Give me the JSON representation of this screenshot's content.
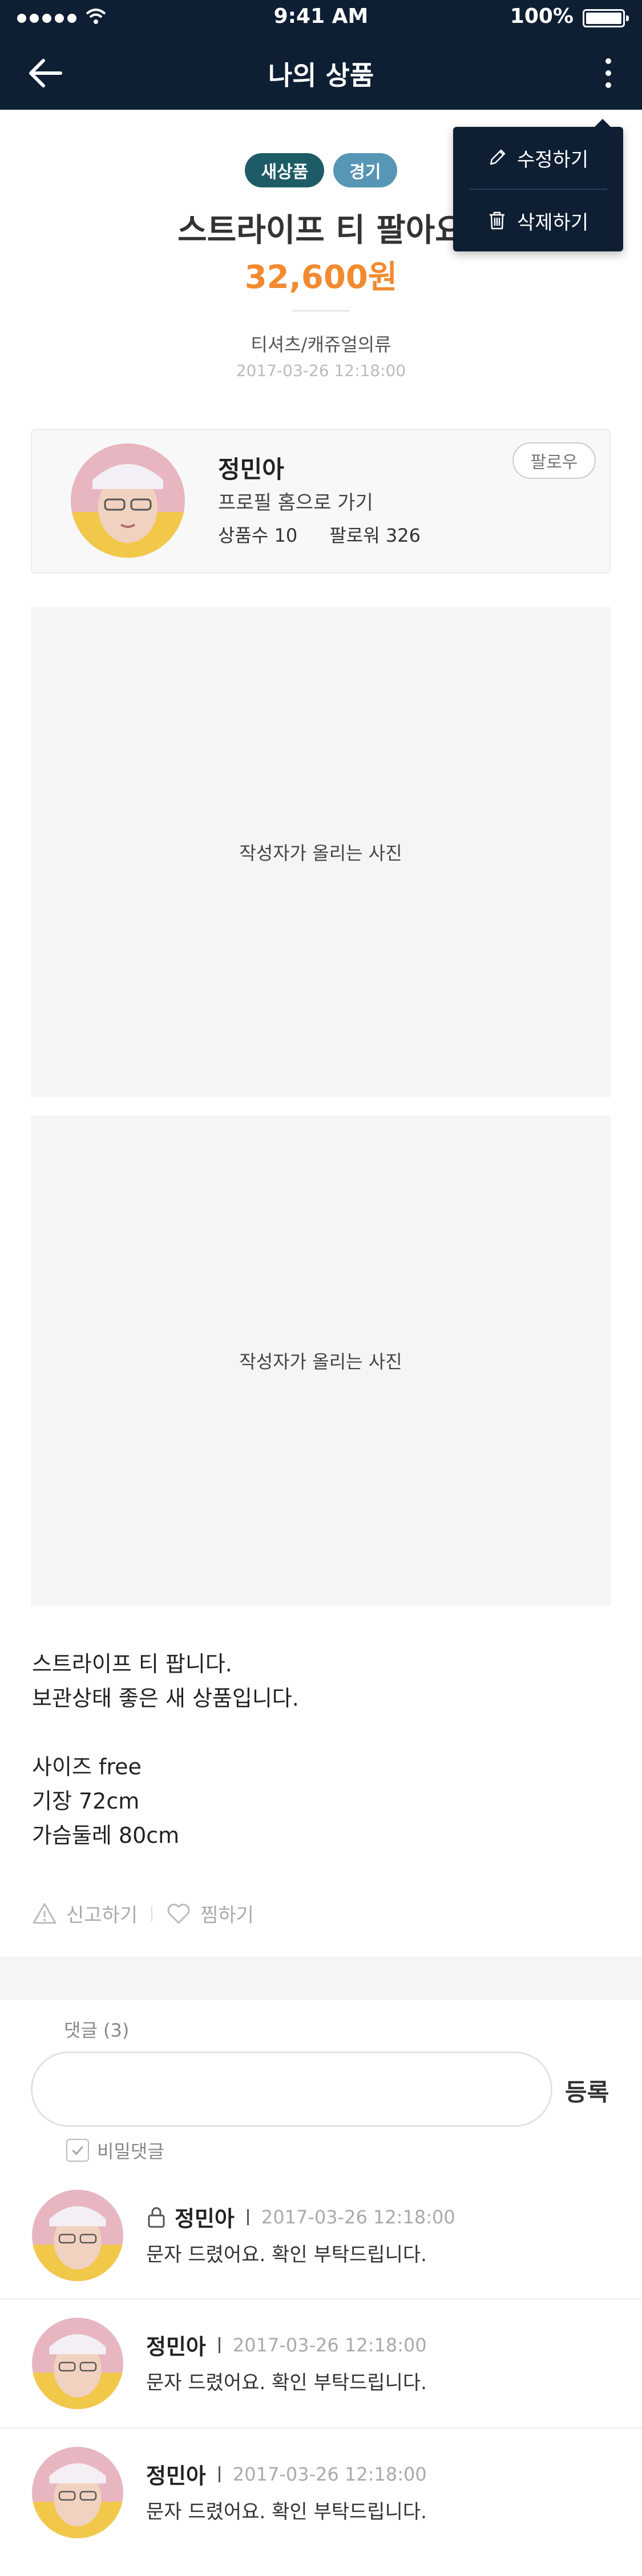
{
  "status_bar": {
    "time": "9:41 AM",
    "battery": "100%"
  },
  "nav": {
    "title": "나의 상품"
  },
  "menu": {
    "edit_label": "수정하기",
    "delete_label": "삭제하기"
  },
  "product": {
    "tags": [
      "새상품",
      "경기"
    ],
    "title": "스트라이프 티 팔아요",
    "price": "32,600원",
    "category": "티셔츠/캐쥬얼의류",
    "date": "2017-03-26  12:18:00"
  },
  "seller": {
    "name": "정민아",
    "profile_link": "프로필 홈으로 가기",
    "items_label": "상품수 10",
    "followers_label": "팔로워 326",
    "follow_button": "팔로우"
  },
  "photos": [
    "작성자가 올리는 사진",
    "작성자가 올리는 사진"
  ],
  "description": [
    "스트라이프 티 팝니다.",
    "보관상태 좋은 새 상품입니다.",
    "",
    "사이즈 free",
    "기장 72cm",
    "가슴둘레 80cm"
  ],
  "actions": {
    "report": "신고하기",
    "like": "찜하기"
  },
  "comments_section": {
    "count_label": "댓글 (3)",
    "submit": "등록",
    "secret_label": "비밀댓글",
    "items": [
      {
        "name": "정민아",
        "date": "2017-03-26  12:18:00",
        "text": "문자 드렸어요. 확인 부탁드립니다.",
        "locked": true
      },
      {
        "name": "정민아",
        "date": "2017-03-26  12:18:00",
        "text": "문자 드렸어요. 확인 부탁드립니다.",
        "locked": false
      },
      {
        "name": "정민아",
        "date": "2017-03-26  12:18:00",
        "text": "문자 드렸어요. 확인 부탁드립니다.",
        "locked": false
      }
    ]
  },
  "colors": {
    "navy": "#0e1f33",
    "price_orange": "#f28a30",
    "tag_new": "#1d5c66",
    "tag_region": "#5796b5"
  },
  "icons": [
    "back-arrow-icon",
    "more-vertical-icon",
    "pencil-icon",
    "trash-icon",
    "warning-icon",
    "heart-icon",
    "lock-icon",
    "check-icon"
  ]
}
